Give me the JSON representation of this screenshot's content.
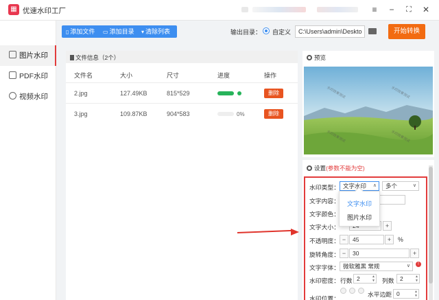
{
  "app": {
    "title": "优速水印工厂"
  },
  "sidebar": {
    "items": [
      {
        "label": "图片水印",
        "active": true
      },
      {
        "label": "PDF水印"
      },
      {
        "label": "视频水印"
      }
    ]
  },
  "toolbar": {
    "add_file": "添加文件",
    "add_dir": "添加目录",
    "clear_list": "清除列表"
  },
  "output": {
    "label": "输出目录：",
    "option": "自定义",
    "path": "C:\\Users\\admin\\Deskto",
    "start": "开始转换"
  },
  "file_panel": {
    "title": "文件信息（2个）",
    "columns": [
      "文件名",
      "大小",
      "尺寸",
      "进度",
      "操作"
    ],
    "rows": [
      {
        "name": "2.jpg",
        "size": "127.49KB",
        "dims": "815*529",
        "progress": 1.0,
        "action": "删除"
      },
      {
        "name": "3.jpg",
        "size": "109.87KB",
        "dims": "904*583",
        "progress": 0,
        "progress_text": "0%",
        "action": "删除"
      }
    ]
  },
  "preview": {
    "title": "预览",
    "watermark_text": "水印效果测试"
  },
  "settings": {
    "title": "设置",
    "warning": "(参数不能为空)",
    "type_label": "水印类型：",
    "type_value": "文字水印",
    "mode_value": "多个",
    "type_options": [
      "文字水印",
      "图片水印"
    ],
    "content_label": "文字内容：",
    "color_label": "文字颜色：",
    "size_label": "文字大小：",
    "size_value": "24",
    "opacity_label": "不透明度：",
    "opacity_value": "45",
    "opacity_unit": "%",
    "angle_label": "旋转角度：",
    "angle_value": "30",
    "font_label": "文字字体：",
    "font_value": "微软雅黑 常规",
    "density_label": "水印密度：",
    "rows_label": "行数",
    "rows_value": "2",
    "cols_label": "列数",
    "cols_value": "2",
    "position_label": "水印位置：",
    "margin_label": "水平边距",
    "margin_value": "0"
  },
  "colors": {
    "accent": "#3d8ef0",
    "start": "#f26b11",
    "danger": "#e85420",
    "progress": "#27b35a",
    "highlight": "#e23b3b"
  }
}
